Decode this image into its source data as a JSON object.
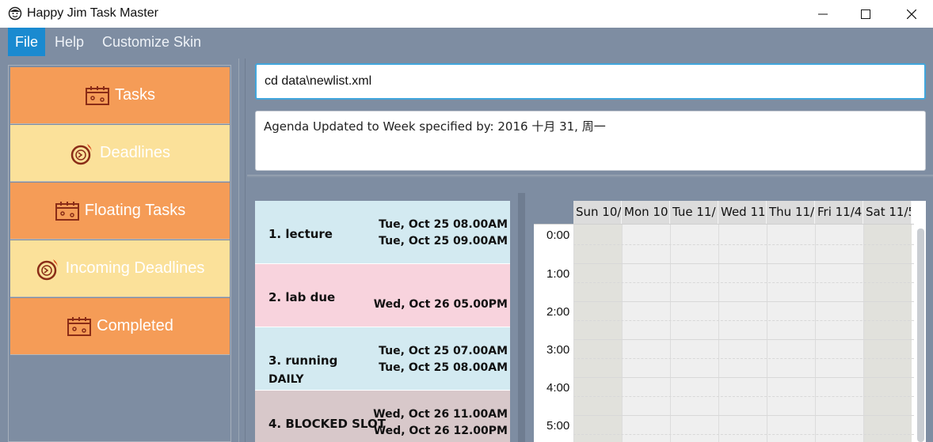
{
  "window": {
    "title": "Happy Jim Task Master",
    "app_icon": "smiley-icon",
    "controls": [
      "minimize-icon",
      "maximize-icon",
      "close-icon"
    ]
  },
  "menu": {
    "items": [
      {
        "label": "File",
        "active": true
      },
      {
        "label": "Help",
        "active": false
      },
      {
        "label": "Customize Skin",
        "active": false
      }
    ]
  },
  "sidebar": {
    "items": [
      {
        "label": "Tasks",
        "icon": "calendar-icon",
        "color": "#f59c57"
      },
      {
        "label": "Deadlines",
        "icon": "clock-fire-icon",
        "color": "#fbe19a"
      },
      {
        "label": "Floating Tasks",
        "icon": "calendar-icon",
        "color": "#f59c57"
      },
      {
        "label": "Incoming Deadlines",
        "icon": "clock-fire-icon",
        "color": "#fbe19a"
      },
      {
        "label": "Completed",
        "icon": "calendar-icon",
        "color": "#f59c57"
      }
    ]
  },
  "command": {
    "value": "cd data\\newlist.xml"
  },
  "result": {
    "text": "Agenda Updated to Week specified by: 2016 十月 31, 周一"
  },
  "tasks": [
    {
      "name": "1. lecture",
      "tag": "",
      "start": "Tue, Oct 25 08.00AM",
      "end": "Tue, Oct 25 09.00AM",
      "color": "#d3eaf1"
    },
    {
      "name": "2. lab due",
      "tag": "",
      "start": "",
      "end": "Wed, Oct 26 05.00PM",
      "color": "#f8d3dd"
    },
    {
      "name": "3. running",
      "tag": "DAILY",
      "start": "Tue, Oct 25 07.00AM",
      "end": "Tue, Oct 25 08.00AM",
      "color": "#d3eaf1"
    },
    {
      "name": "4. BLOCKED SLOT",
      "tag": "",
      "start": "Wed, Oct 26 11.00AM",
      "end": "Wed, Oct 26 12.00PM",
      "color": "#d8c8ca"
    }
  ],
  "calendar": {
    "days": [
      "Sun 10/",
      "Mon 10",
      "Tue 11/",
      "Wed 11",
      "Thu 11/",
      "Fri 11/4,",
      "Sat 11/5"
    ],
    "hours": [
      "0:00",
      "1:00",
      "2:00",
      "3:00",
      "4:00",
      "5:00"
    ]
  }
}
